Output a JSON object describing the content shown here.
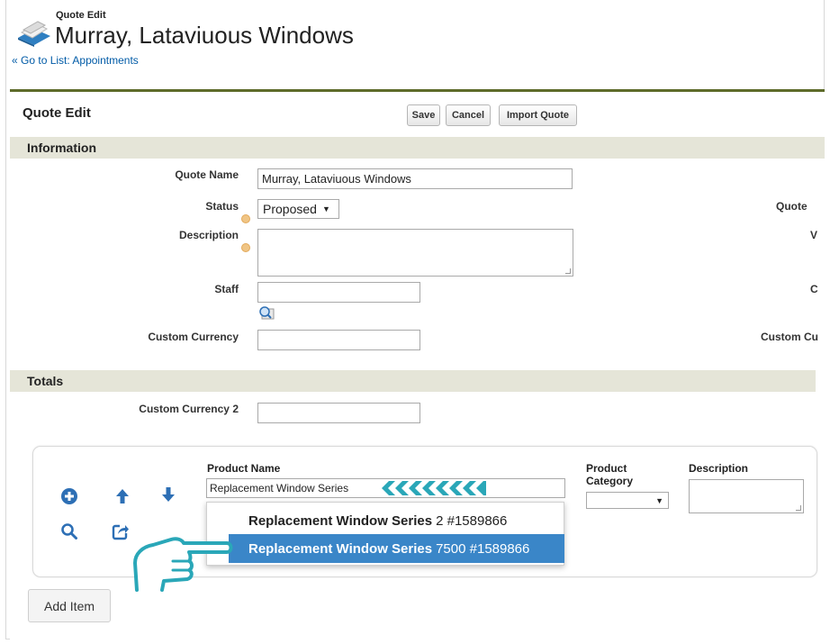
{
  "header": {
    "subtitle": "Quote Edit",
    "title": "Murray, Lataviuous Windows",
    "back_prefix": "«",
    "back_link": "Go to List: Appointments"
  },
  "page_block": {
    "title": "Quote Edit",
    "buttons": {
      "save": "Save",
      "cancel": "Cancel",
      "import": "Import Quote"
    }
  },
  "sections": {
    "information": "Information",
    "totals": "Totals"
  },
  "information": {
    "quote_name_label": "Quote Name",
    "quote_name_value": "Murray, Lataviuous Windows",
    "status_label": "Status",
    "status_value": "Proposed",
    "description_label": "Description",
    "staff_label": "Staff",
    "custom_currency_label": "Custom Currency",
    "right_quote_label": "Quote",
    "right_v_label": "V",
    "right_c_label": "C",
    "right_custom_cu_label": "Custom Cu"
  },
  "totals": {
    "custom_currency_2_label": "Custom Currency 2"
  },
  "product_item": {
    "product_name_label": "Product Name",
    "product_name_value": "Replacement Window Series",
    "product_category_label": "Product Category",
    "description_label": "Description",
    "suggestions": [
      {
        "strong": "Replacement Window Series",
        "rest": "2 #1589866"
      },
      {
        "strong": "Replacement Window Series",
        "rest": "7500 #1589866"
      }
    ],
    "add_item_label": "Add Item"
  },
  "colors": {
    "accent_line": "#5e6b2a",
    "section_bg": "#e5e5d8",
    "highlight": "#3a86c8",
    "icon_blue": "#2d6fb5",
    "annotation_teal": "#2aa7b8",
    "link": "#015ba7"
  },
  "icons": {
    "header": "document-stack-icon",
    "lookup": "lookup-magnifier-icon",
    "add": "plus-circle-icon",
    "up": "arrow-up-icon",
    "down": "arrow-down-icon",
    "search": "search-icon",
    "share": "share-icon",
    "annotation_arrow": "chevron-arrows-icon",
    "annotation_hand": "pointing-hand-icon"
  }
}
